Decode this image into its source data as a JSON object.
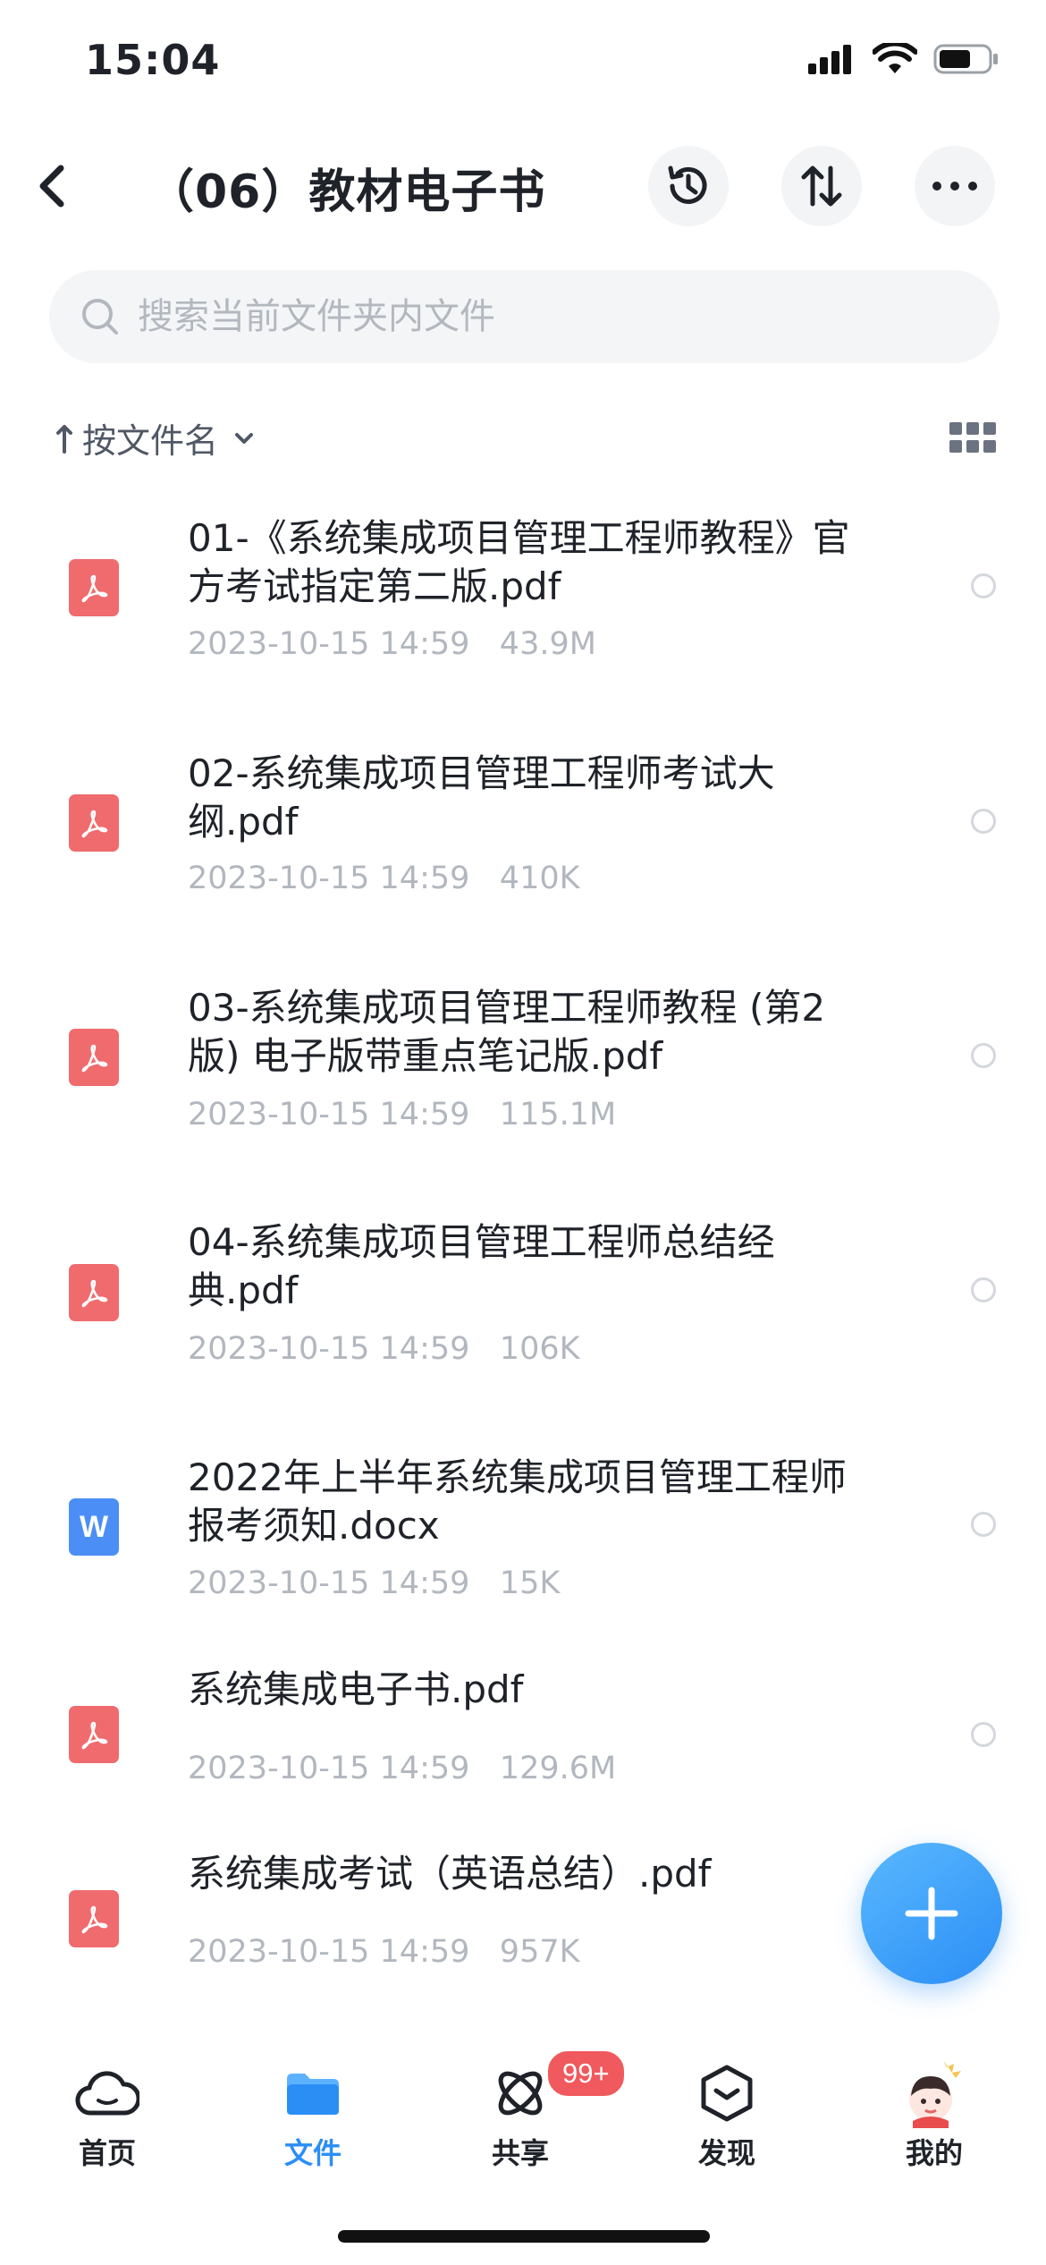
{
  "status_bar": {
    "time": "15:04"
  },
  "header": {
    "title": "（06）教材电子书"
  },
  "search": {
    "placeholder": "搜索当前文件夹内文件"
  },
  "sort": {
    "label": "按文件名"
  },
  "files": [
    {
      "name": "01-《系统集成项目管理工程师教程》官方考试指定第二版.pdf",
      "date": "2023-10-15 14:59",
      "size": "43.9M",
      "type": "pdf"
    },
    {
      "name": "02-系统集成项目管理工程师考试大纲.pdf",
      "date": "2023-10-15 14:59",
      "size": "410K",
      "type": "pdf"
    },
    {
      "name": "03-系统集成项目管理工程师教程 (第2版) 电子版带重点笔记版.pdf",
      "date": "2023-10-15 14:59",
      "size": "115.1M",
      "type": "pdf"
    },
    {
      "name": "04-系统集成项目管理工程师总结经典.pdf",
      "date": "2023-10-15 14:59",
      "size": "106K",
      "type": "pdf"
    },
    {
      "name": "2022年上半年系统集成项目管理工程师报考须知.docx",
      "date": "2023-10-15 14:59",
      "size": "15K",
      "type": "docx",
      "icon_letter": "W"
    },
    {
      "name": "系统集成电子书.pdf",
      "date": "2023-10-15 14:59",
      "size": "129.6M",
      "type": "pdf"
    },
    {
      "name": "系统集成考试（英语总结）.pdf",
      "date": "2023-10-15 14:59",
      "size": "957K",
      "type": "pdf"
    }
  ],
  "tabbar": {
    "items": [
      {
        "label": "首页",
        "icon": "cloud-icon"
      },
      {
        "label": "文件",
        "icon": "folder-icon",
        "active": true
      },
      {
        "label": "共享",
        "icon": "orbit-icon",
        "badge": "99+"
      },
      {
        "label": "发现",
        "icon": "discover-icon"
      },
      {
        "label": "我的",
        "icon": "avatar-icon"
      }
    ]
  },
  "colors": {
    "accent": "#2b8ef5",
    "pdf": "#ef6b6e",
    "docx": "#4b8ef5",
    "badge": "#f0595d"
  }
}
